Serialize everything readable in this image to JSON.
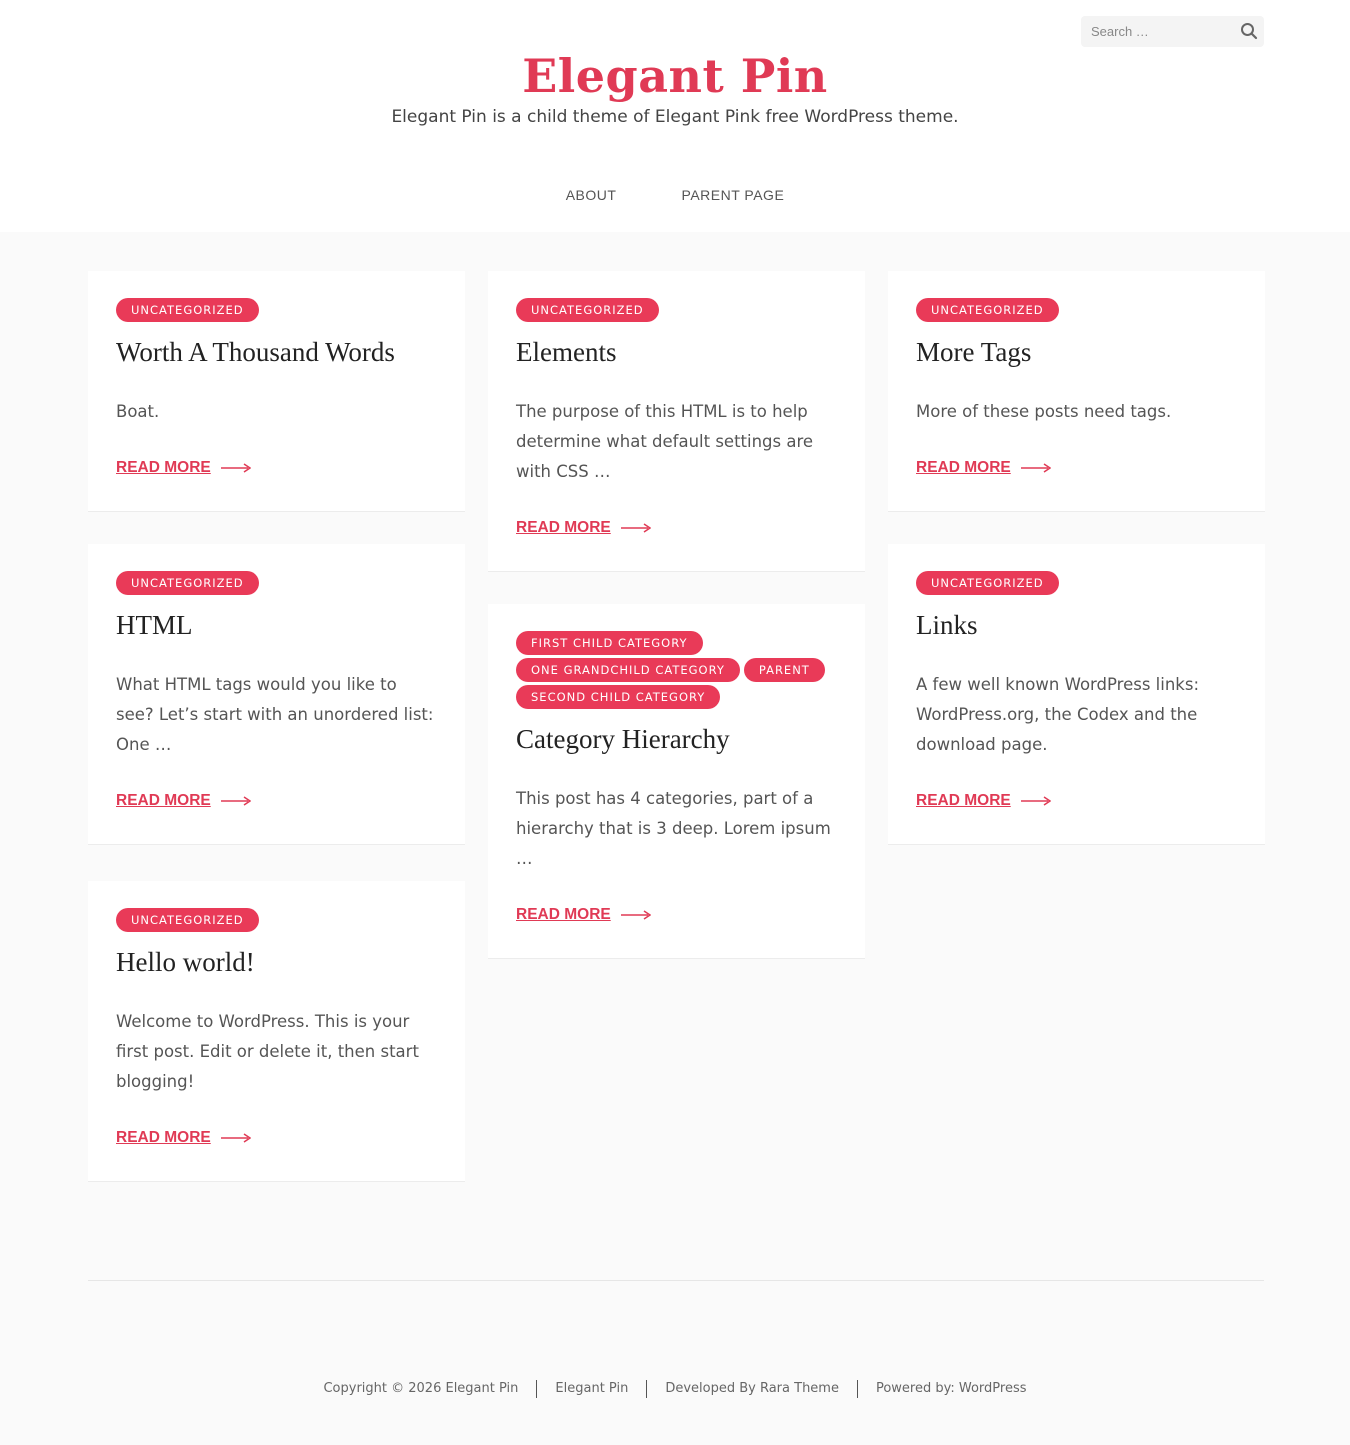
{
  "header": {
    "title": "Elegant Pin",
    "description": "Elegant Pin is a child theme of Elegant Pink free WordPress theme.",
    "search_placeholder": "Search …"
  },
  "nav": {
    "items": [
      {
        "label": "ABOUT"
      },
      {
        "label": "PARENT PAGE"
      }
    ]
  },
  "posts": [
    {
      "categories": [
        "UNCATEGORIZED"
      ],
      "title": "Worth A Thousand Words",
      "excerpt": "Boat.",
      "read_more": "READ MORE"
    },
    {
      "categories": [
        "UNCATEGORIZED"
      ],
      "title": "Elements",
      "excerpt": "The purpose of this HTML is to help determine what default settings are with CSS …",
      "read_more": "READ MORE"
    },
    {
      "categories": [
        "UNCATEGORIZED"
      ],
      "title": "More Tags",
      "excerpt": "More of these posts need tags.",
      "read_more": "READ MORE"
    },
    {
      "categories": [
        "UNCATEGORIZED"
      ],
      "title": "HTML",
      "excerpt": "What HTML tags would you like to see? Let’s start with an unordered list: One …",
      "read_more": "READ MORE"
    },
    {
      "categories": [
        "FIRST CHILD CATEGORY",
        "ONE GRANDCHILD CATEGORY",
        "PARENT",
        "SECOND CHILD CATEGORY"
      ],
      "title": "Category Hierarchy",
      "excerpt": "This post has 4 categories, part of a hierarchy that is 3 deep. Lorem ipsum …",
      "read_more": "READ MORE"
    },
    {
      "categories": [
        "UNCATEGORIZED"
      ],
      "title": "Links",
      "excerpt": "A few well known WordPress links: WordPress.org, the Codex and the download page.",
      "read_more": "READ MORE"
    },
    {
      "categories": [
        "UNCATEGORIZED"
      ],
      "title": "Hello world!",
      "excerpt": "Welcome to WordPress. This is your first post. Edit or delete it, then start blogging!",
      "read_more": "READ MORE"
    }
  ],
  "footer": {
    "copyright": "Copyright © 2026 Elegant Pin",
    "site_link": "Elegant Pin",
    "developed_by": "Developed By Rara Theme",
    "powered_by": "Powered by: WordPress"
  },
  "colors": {
    "accent": "#e93a58",
    "title": "#e03a55",
    "background": "#fafafa"
  }
}
